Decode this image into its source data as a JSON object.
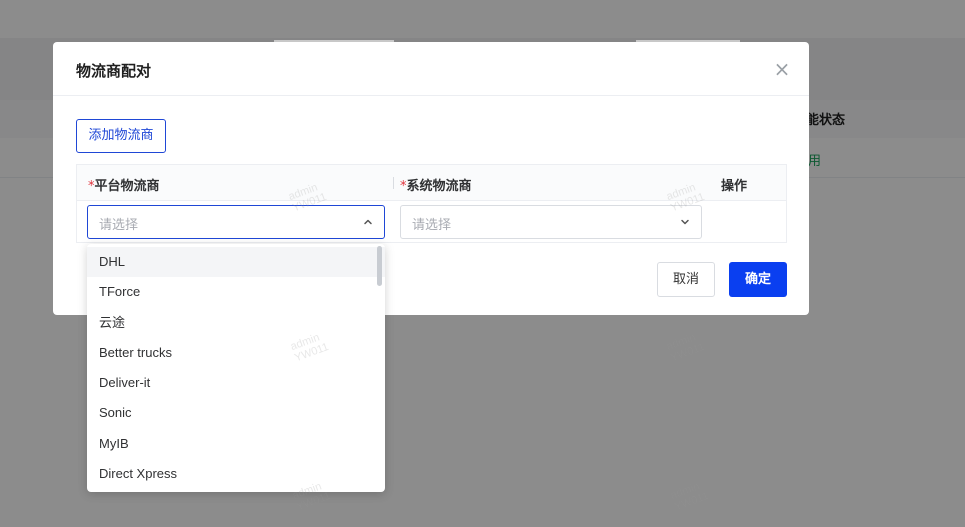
{
  "background": {
    "column_title": "能状态",
    "row_value": "用"
  },
  "modal": {
    "title": "物流商配对",
    "close_symbol": "×",
    "add_button": "添加物流商",
    "table": {
      "required_mark": "*",
      "col_platform": "平台物流商",
      "col_system": "系统物流商",
      "col_action": "操作",
      "platform_placeholder": "请选择",
      "system_placeholder": "请选择"
    },
    "cancel_button": "取消",
    "confirm_button": "确定"
  },
  "dropdown": {
    "options": [
      "DHL",
      "TForce",
      "云途",
      "Better trucks",
      "Deliver-it",
      "Sonic",
      "MyIB",
      "Direct Xpress"
    ]
  },
  "watermark": {
    "line1": "admin",
    "line2": "YW011"
  },
  "colors": {
    "primary": "#0a3ff0",
    "link": "#1f47d6",
    "required": "#e0333c",
    "status_green": "#1aa35b"
  },
  "icons": {
    "close": "close-icon",
    "select_open": "chevron-up-icon",
    "select_closed": "chevron-down-icon"
  }
}
